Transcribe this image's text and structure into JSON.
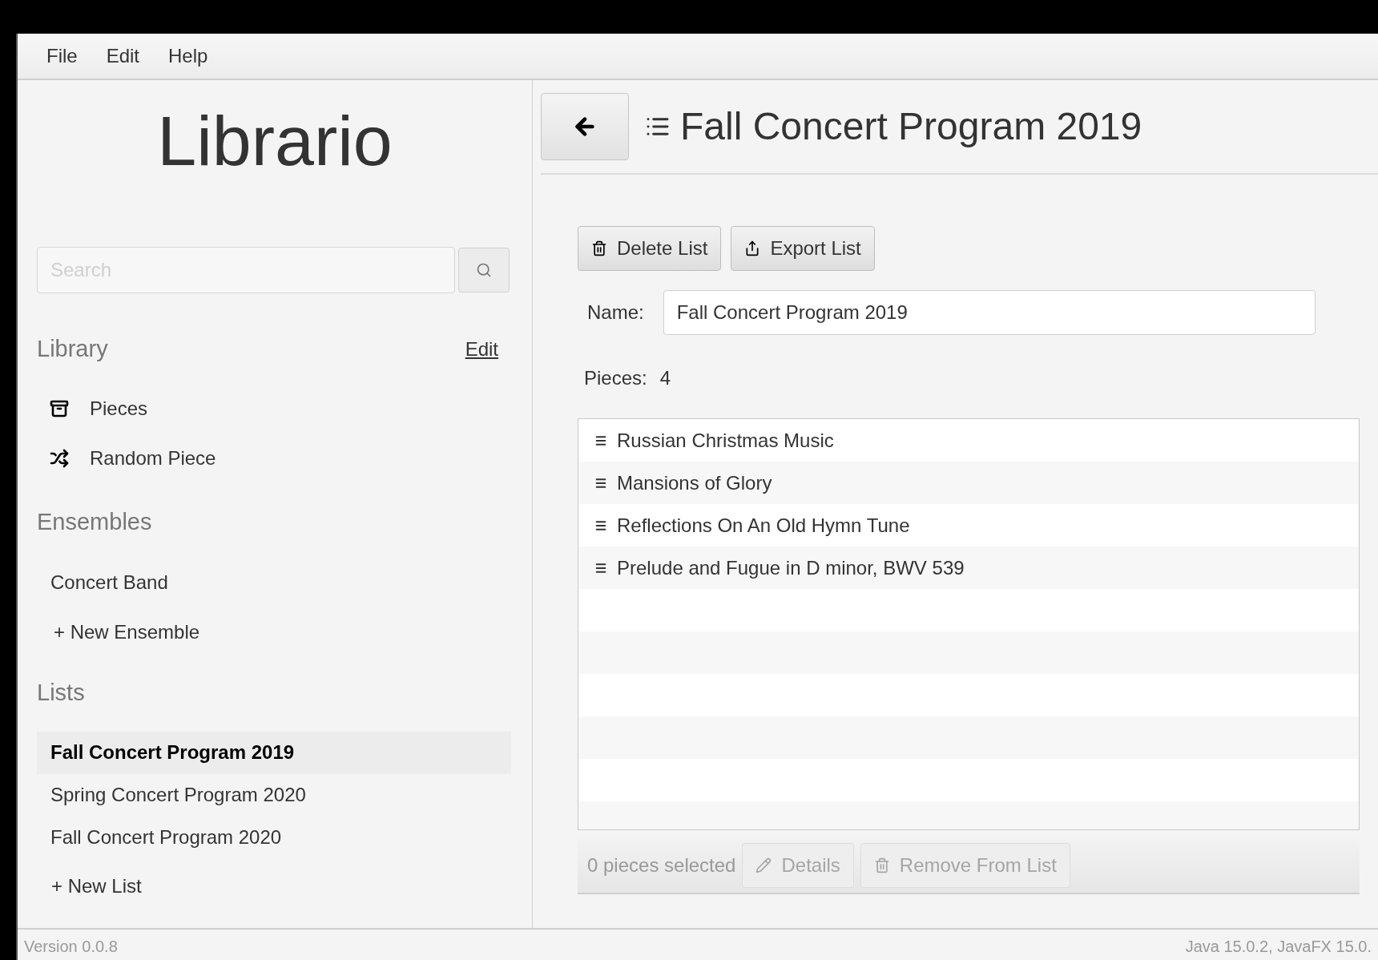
{
  "menu": [
    "File",
    "Edit",
    "Help"
  ],
  "sidebar": {
    "app_title": "Librario",
    "search": {
      "placeholder": "Search"
    },
    "library": {
      "title": "Library",
      "edit_link": "Edit",
      "items": [
        {
          "label": "Pieces",
          "kind": "pieces"
        },
        {
          "label": "Random Piece",
          "kind": "random"
        }
      ]
    },
    "ensembles": {
      "title": "Ensembles",
      "items": [
        "Concert Band"
      ],
      "new_item": "+ New Ensemble"
    },
    "lists": {
      "title": "Lists",
      "items": [
        {
          "label": "Fall Concert Program 2019",
          "selected": true
        },
        {
          "label": "Spring Concert Program 2020",
          "selected": false
        },
        {
          "label": "Fall Concert Program 2020",
          "selected": false
        }
      ],
      "new_item": "+ New List"
    }
  },
  "header": {
    "title": "Fall Concert Program 2019"
  },
  "actions": [
    {
      "label": "Delete List",
      "kind": "delete"
    },
    {
      "label": "Export List",
      "kind": "export"
    }
  ],
  "name_label": "Name:",
  "name_value": "Fall Concert Program 2019",
  "pieces_label": "Pieces:",
  "pieces_count": "4",
  "pieces": [
    "Russian Christmas Music",
    "Mansions of Glory",
    "Reflections On An Old Hymn Tune",
    "Prelude and Fugue in D minor, BWV 539"
  ],
  "footer": {
    "selection_text": "0 pieces selected",
    "buttons": [
      {
        "label": "Details",
        "kind": "details",
        "disabled": true
      },
      {
        "label": "Remove From List",
        "kind": "remove",
        "disabled": true
      }
    ]
  },
  "status_bar": {
    "left": "Version 0.0.8",
    "right": "Java 15.0.2, JavaFX 15.0."
  }
}
